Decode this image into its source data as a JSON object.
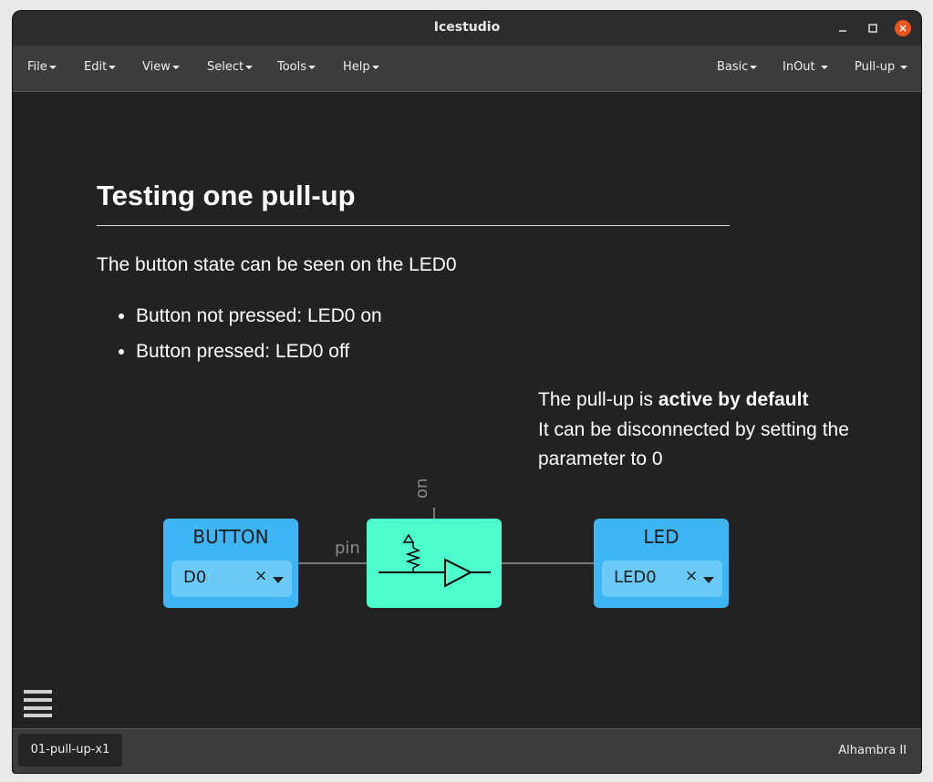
{
  "window": {
    "title": "Icestudio"
  },
  "menubar": {
    "left": [
      "File",
      "Edit",
      "View",
      "Select",
      "Tools",
      "Help"
    ],
    "right": [
      "Basic",
      "InOut",
      "Pull-up"
    ]
  },
  "content": {
    "heading": "Testing one pull-up",
    "paragraph": "The button state can be seen on the LED0",
    "bullets": [
      "Button not pressed: LED0 on",
      "Button pressed: LED0 off"
    ],
    "note": {
      "line1_prefix": "The pull-up is ",
      "line1_bold": "active by default",
      "line2": "It can be disconnected by setting the",
      "line3": "parameter to 0"
    }
  },
  "circuit": {
    "input_block": {
      "title": "BUTTON",
      "value": "D0"
    },
    "pullup_block": {
      "pin_label": "pin",
      "param_label": "on"
    },
    "output_block": {
      "title": "LED",
      "value": "LED0"
    },
    "clear_symbol": "×"
  },
  "statusbar": {
    "file_tab": "01-pull-up-x1",
    "board": "Alhambra II"
  },
  "colors": {
    "io_block": "#3eb6f6",
    "pullup_block": "#4dfecc",
    "close_button": "#e95420",
    "background": "#222222"
  },
  "icons": [
    "minimize-icon",
    "maximize-icon",
    "close-icon",
    "hamburger-menu-icon",
    "resistor-icon",
    "buffer-icon",
    "dropdown-caret-icon"
  ]
}
